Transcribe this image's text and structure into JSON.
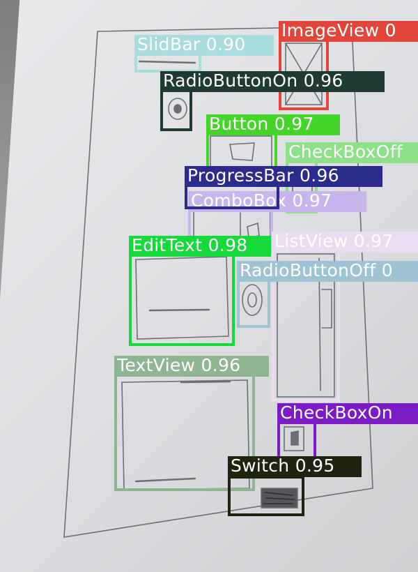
{
  "detections": [
    {
      "id": "imageview",
      "text": "ImageView 0",
      "color": "#e0473a",
      "fg": "#ffffff"
    },
    {
      "id": "slidbar",
      "text": "SlidBar 0.90",
      "color": "#a9dcdc",
      "fg": "#ffffff"
    },
    {
      "id": "radiobuttonon",
      "text": "RadioButtonOn 0.96",
      "color": "#1f3a33",
      "fg": "#ffffff"
    },
    {
      "id": "button",
      "text": "Button 0.97",
      "color": "#44d42a",
      "fg": "#ffffff"
    },
    {
      "id": "checkboxoff",
      "text": "CheckBoxOff",
      "color": "#8fe08a",
      "fg": "#ffffff"
    },
    {
      "id": "progressbar",
      "text": "ProgressBar 0.96",
      "color": "#2b2b8c",
      "fg": "#ffffff"
    },
    {
      "id": "combobox",
      "text": "ComboBox 0.97",
      "color": "#c8b5ee",
      "fg": "#ffffff"
    },
    {
      "id": "edittext",
      "text": "EditText 0.98",
      "color": "#16d93c",
      "fg": "#ffffff"
    },
    {
      "id": "listview",
      "text": "ListView 0.97",
      "color": "#ebdcef",
      "fg": "#ffffff"
    },
    {
      "id": "radiobuttonoff",
      "text": "RadioButtonOff 0",
      "color": "#9fc3d3",
      "fg": "#ffffff"
    },
    {
      "id": "textview",
      "text": "TextView 0.96",
      "color": "#90b592",
      "fg": "#ffffff"
    },
    {
      "id": "checkboxon",
      "text": "CheckBoxOn",
      "color": "#7a1bc4",
      "fg": "#ffffff"
    },
    {
      "id": "switch",
      "text": "Switch 0.95",
      "color": "#1e2410",
      "fg": "#ffffff"
    }
  ]
}
